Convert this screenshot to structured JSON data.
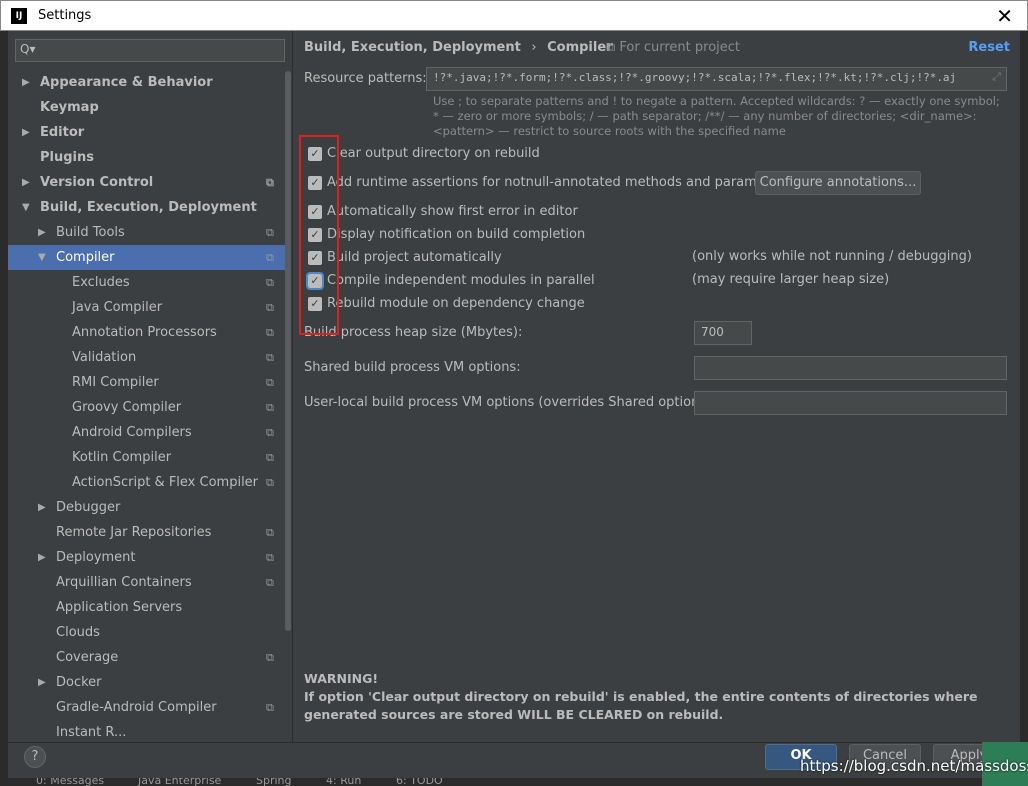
{
  "window": {
    "title": "Settings",
    "close": "✕"
  },
  "sidebar": {
    "search_placeholder": "Q▾",
    "items": [
      {
        "label": "Appearance & Behavior",
        "level": 0,
        "arrow": "▶",
        "bold": true
      },
      {
        "label": "Keymap",
        "level": 0,
        "bold": true
      },
      {
        "label": "Editor",
        "level": 0,
        "arrow": "▶",
        "bold": true
      },
      {
        "label": "Plugins",
        "level": 0,
        "bold": true
      },
      {
        "label": "Version Control",
        "level": 0,
        "arrow": "▶",
        "bold": true,
        "copy": true
      },
      {
        "label": "Build, Execution, Deployment",
        "level": 0,
        "arrow": "▼",
        "bold": true
      },
      {
        "label": "Build Tools",
        "level": 1,
        "arrow": "▶",
        "copy": true
      },
      {
        "label": "Compiler",
        "level": 1,
        "arrow": "▼",
        "copy": true,
        "selected": true
      },
      {
        "label": "Excludes",
        "level": 2,
        "copy": true
      },
      {
        "label": "Java Compiler",
        "level": 2,
        "copy": true
      },
      {
        "label": "Annotation Processors",
        "level": 2,
        "copy": true
      },
      {
        "label": "Validation",
        "level": 2,
        "copy": true
      },
      {
        "label": "RMI Compiler",
        "level": 2,
        "copy": true
      },
      {
        "label": "Groovy Compiler",
        "level": 2,
        "copy": true
      },
      {
        "label": "Android Compilers",
        "level": 2,
        "copy": true
      },
      {
        "label": "Kotlin Compiler",
        "level": 2,
        "copy": true
      },
      {
        "label": "ActionScript & Flex Compiler",
        "level": 2,
        "copy": true
      },
      {
        "label": "Debugger",
        "level": 1,
        "arrow": "▶"
      },
      {
        "label": "Remote Jar Repositories",
        "level": 1,
        "copy": true
      },
      {
        "label": "Deployment",
        "level": 1,
        "arrow": "▶",
        "copy": true
      },
      {
        "label": "Arquillian Containers",
        "level": 1,
        "copy": true
      },
      {
        "label": "Application Servers",
        "level": 1
      },
      {
        "label": "Clouds",
        "level": 1
      },
      {
        "label": "Coverage",
        "level": 1,
        "copy": true
      },
      {
        "label": "Docker",
        "level": 1,
        "arrow": "▶"
      },
      {
        "label": "Gradle-Android Compiler",
        "level": 1,
        "copy": true
      },
      {
        "label": "Instant R...",
        "level": 1
      }
    ]
  },
  "main": {
    "breadcrumb": {
      "parent": "Build, Execution, Deployment",
      "sep": "›",
      "current": "Compiler"
    },
    "scope": "⧉ For current project",
    "reset": "Reset",
    "resource_label": "Resource patterns:",
    "resource_value": "!?*.java;!?*.form;!?*.class;!?*.groovy;!?*.scala;!?*.flex;!?*.kt;!?*.clj;!?*.aj",
    "hint": "Use ; to separate patterns and ! to negate a pattern. Accepted wildcards: ? — exactly one symbol; * — zero or more symbols; / — path separator; /**/ — any number of directories; <dir_name>:<pattern> — restrict to source roots with the specified name",
    "checkboxes": [
      {
        "label": "Clear output directory on rebuild",
        "checked": true
      },
      {
        "label": "Add runtime assertions for notnull-annotated methods and parameters",
        "checked": true
      },
      {
        "label": "Automatically show first error in editor",
        "checked": true
      },
      {
        "label": "Display notification on build completion",
        "checked": true
      },
      {
        "label": "Build project automatically",
        "checked": true,
        "note": "(only works while not running / debugging)"
      },
      {
        "label": "Compile independent modules in parallel",
        "checked": true,
        "note": "(may require larger heap size)"
      },
      {
        "label": "Rebuild module on dependency change",
        "checked": true
      }
    ],
    "configure_button": "Configure annotations...",
    "heap_label": "Build process heap size (Mbytes):",
    "heap_value": "700",
    "shared_vm_label": "Shared build process VM options:",
    "shared_vm_value": "",
    "user_vm_label": "User-local build process VM options (overrides Shared options):",
    "user_vm_value": "",
    "warning_title": "WARNING!",
    "warning_text": "If option 'Clear output directory on rebuild' is enabled, the entire contents of directories where generated sources are stored WILL BE CLEARED on rebuild."
  },
  "footer": {
    "help": "?",
    "ok": "OK",
    "cancel": "Cancel",
    "apply": "Apply"
  },
  "statusbar": {
    "items": [
      "0: Messages",
      "Java Enterprise",
      "Spring",
      "4: Run",
      "6: TODO"
    ]
  },
  "watermark": "https://blog.csdn.net/massdoss",
  "colors": {
    "accent": "#4b6eaf",
    "link": "#589df6",
    "highlight_box": "#e0201e",
    "background": "#3c3f41"
  }
}
